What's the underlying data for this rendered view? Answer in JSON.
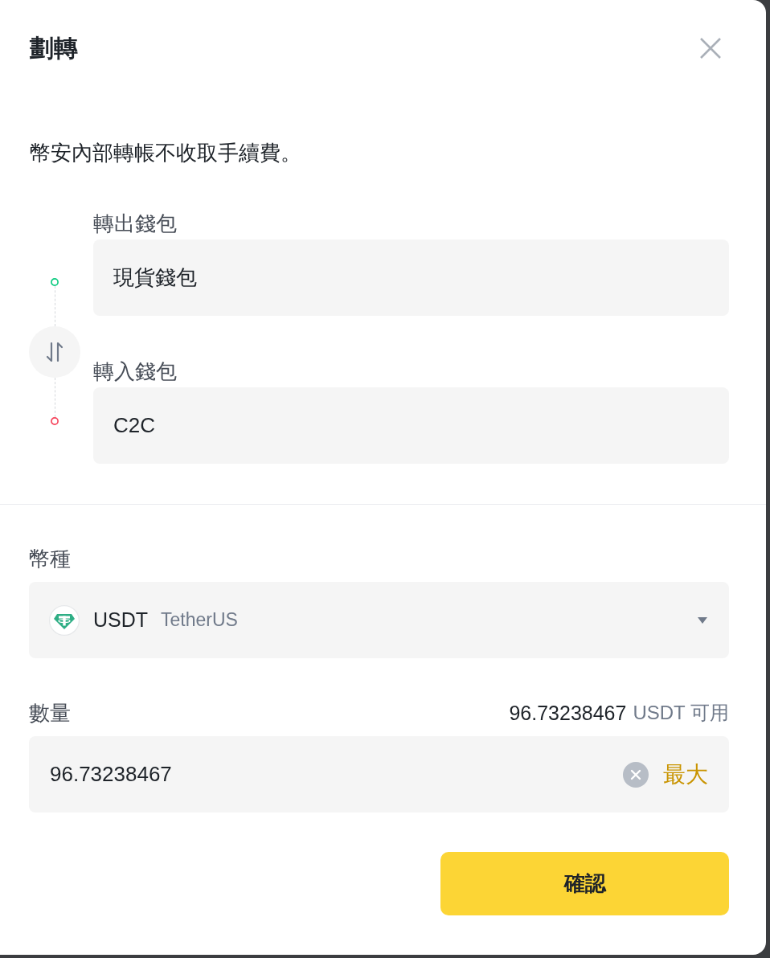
{
  "dialog": {
    "title": "劃轉"
  },
  "notice": "幣安內部轉帳不收取手續費。",
  "wallets": [
    {
      "label": "轉出錢包",
      "value": "現貨錢包"
    },
    {
      "label": "轉入錢包",
      "value": "C2C"
    }
  ],
  "coin": {
    "label": "幣種",
    "symbol": "USDT",
    "name": "TetherUS"
  },
  "amount": {
    "label": "數量",
    "available": "96.73238467",
    "available_unit": "USDT 可用",
    "value": "96.73238467",
    "max_button": "最大"
  },
  "confirm_button": "確認"
}
